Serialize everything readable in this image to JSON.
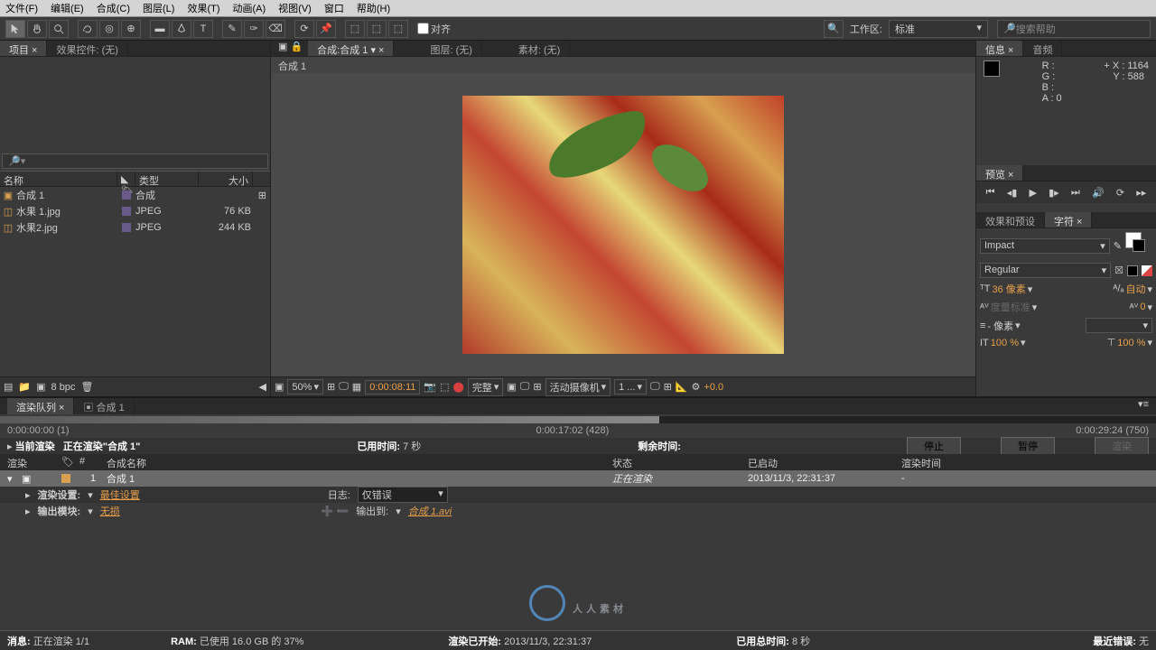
{
  "menu": [
    "文件(F)",
    "编辑(E)",
    "合成(C)",
    "图层(L)",
    "效果(T)",
    "动画(A)",
    "视图(V)",
    "窗口",
    "帮助(H)"
  ],
  "toolbar": {
    "align": "对齐",
    "workspace_lbl": "工作区:",
    "workspace": "标准",
    "search_placeholder": "搜索帮助"
  },
  "project": {
    "tab1": "项目",
    "tab2": "效果控件:  (无)",
    "headers": {
      "name": "名称",
      "type": "类型",
      "size": "大小"
    },
    "items": [
      {
        "icon": "▣",
        "name": "合成 1",
        "type": "合成",
        "size": ""
      },
      {
        "icon": "◫",
        "name": "水果 1.jpg",
        "type": "JPEG",
        "size": "76 KB"
      },
      {
        "icon": "◫",
        "name": "水果2.jpg",
        "type": "JPEG",
        "size": "244 KB"
      }
    ],
    "bpc": "8 bpc"
  },
  "comp": {
    "tab": "合成:合成 1",
    "tab2": "图层: (无)",
    "tab3": "素材: (无)",
    "label": "合成 1"
  },
  "viewer": {
    "zoom": "50%",
    "time": "0:00:08:11",
    "quality": "完整",
    "camera": "活动摄像机",
    "views": "1 ...",
    "exposure": "+0.0"
  },
  "info": {
    "tab1": "信息",
    "tab2": "音频",
    "r": "R :",
    "g": "G :",
    "b": "B :",
    "a": "A : 0",
    "x": "X : 1164",
    "y": "Y : 588"
  },
  "preview": {
    "tab": "预览"
  },
  "char": {
    "tab1": "效果和预设",
    "tab2": "字符",
    "font": "Impact",
    "style": "Regular",
    "size": "36 像素",
    "leading": "自动",
    "kerning": "度量标准",
    "tracking": "0",
    "stroke": "- 像素",
    "vscale": "100 %",
    "hscale": "100 %"
  },
  "rq": {
    "tab1": "渲染队列",
    "tab2": "合成 1",
    "t_start": "0:00:00:00 (1)",
    "t_mid": "0:00:17:02 (428)",
    "t_end": "0:00:29:24 (750)",
    "current": "当前渲染",
    "rendering": "正在渲染\"合成 1\"",
    "elapsed_lbl": "已用时间:",
    "elapsed": "7 秒",
    "remaining_lbl": "剩余时间:",
    "btn_stop": "停止",
    "btn_pause": "暂停",
    "btn_render": "渲染",
    "h_render": "渲染",
    "h_num": "#",
    "h_name": "合成名称",
    "h_status": "状态",
    "h_started": "已启动",
    "h_time": "渲染时间",
    "row_num": "1",
    "row_name": "合成 1",
    "row_status": "正在渲染",
    "row_started": "2013/11/3, 22:31:37",
    "row_time": "-",
    "rs_lbl": "渲染设置:",
    "rs_val": "最佳设置",
    "log_lbl": "日志:",
    "log_val": "仅错误",
    "om_lbl": "输出模块:",
    "om_val": "无损",
    "out_lbl": "输出到:",
    "out_val": "合成 1.avi"
  },
  "status": {
    "msg_lbl": "消息:",
    "msg": "正在渲染 1/1",
    "ram_lbl": "RAM:",
    "ram": "已使用 16.0 GB 的 37%",
    "start_lbl": "渲染已开始:",
    "start": "2013/11/3, 22:31:37",
    "total_lbl": "已用总时间:",
    "total": "8 秒",
    "err_lbl": "最近错误:",
    "err": "无"
  },
  "watermark": "人人素材"
}
